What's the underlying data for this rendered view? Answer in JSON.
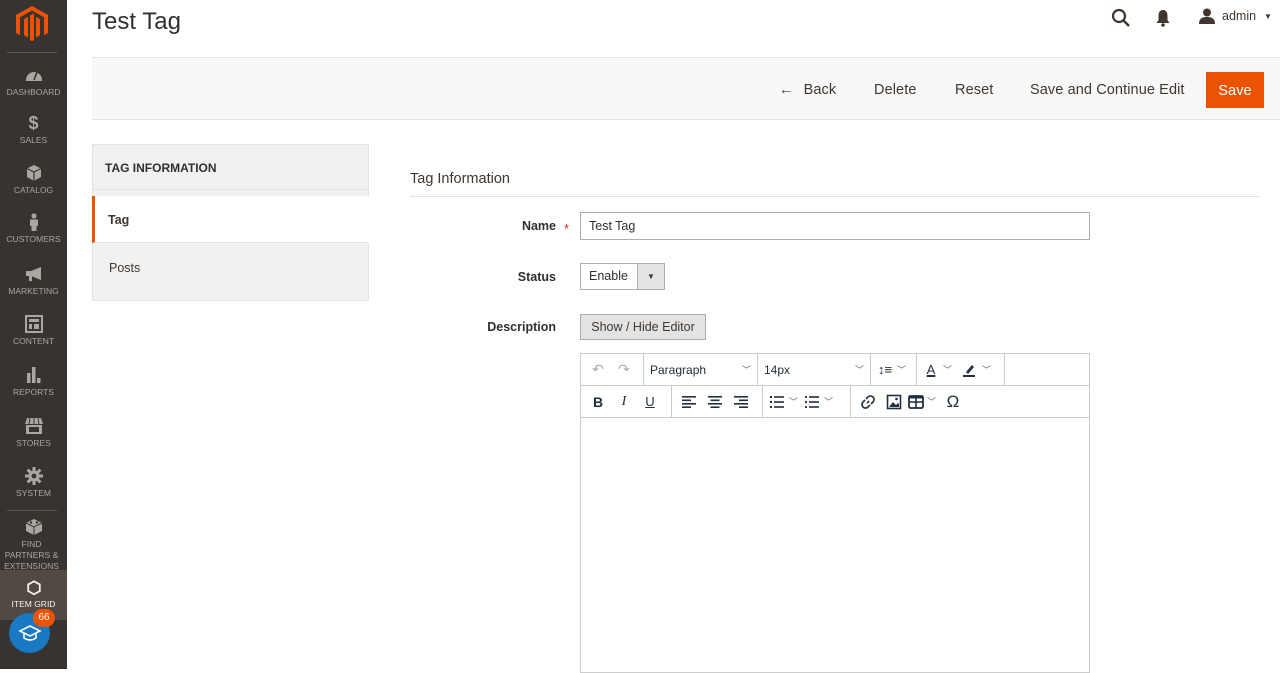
{
  "page": {
    "title": "Test Tag"
  },
  "header": {
    "user_name": "admin",
    "icons": [
      "search-icon",
      "bell-icon",
      "user-icon"
    ]
  },
  "sidebar": {
    "items": [
      {
        "label": "Dashboard",
        "icon": "dashboard-icon"
      },
      {
        "label": "Sales",
        "icon": "dollar-icon"
      },
      {
        "label": "Catalog",
        "icon": "box-icon"
      },
      {
        "label": "Customers",
        "icon": "person-icon"
      },
      {
        "label": "Marketing",
        "icon": "megaphone-icon"
      },
      {
        "label": "Content",
        "icon": "layout-icon"
      },
      {
        "label": "Reports",
        "icon": "bar-chart-icon"
      },
      {
        "label": "Stores",
        "icon": "storefront-icon"
      },
      {
        "label": "System",
        "icon": "gear-icon"
      },
      {
        "label": "Find Partners & Extensions",
        "icon": "blocks-icon"
      },
      {
        "label": "Item Grid",
        "icon": "hexagon-icon"
      }
    ],
    "edu_badge_count": "66"
  },
  "actions": {
    "back": "Back",
    "delete": "Delete",
    "reset": "Reset",
    "save_continue": "Save and Continue Edit",
    "save": "Save"
  },
  "tabs": {
    "title": "TAG INFORMATION",
    "items": [
      {
        "label": "Tag",
        "active": true
      },
      {
        "label": "Posts",
        "active": false
      }
    ]
  },
  "form": {
    "section_title": "Tag Information",
    "name_label": "Name",
    "name_value": "Test Tag",
    "status_label": "Status",
    "status_value": "Enable",
    "description_label": "Description",
    "toggle_editor_label": "Show / Hide Editor"
  },
  "editor": {
    "block_format": "Paragraph",
    "font_size": "14px",
    "content": ""
  },
  "colors": {
    "accent": "#eb5202",
    "sidebar_bg": "#373330",
    "edu_blue": "#1979c3"
  }
}
